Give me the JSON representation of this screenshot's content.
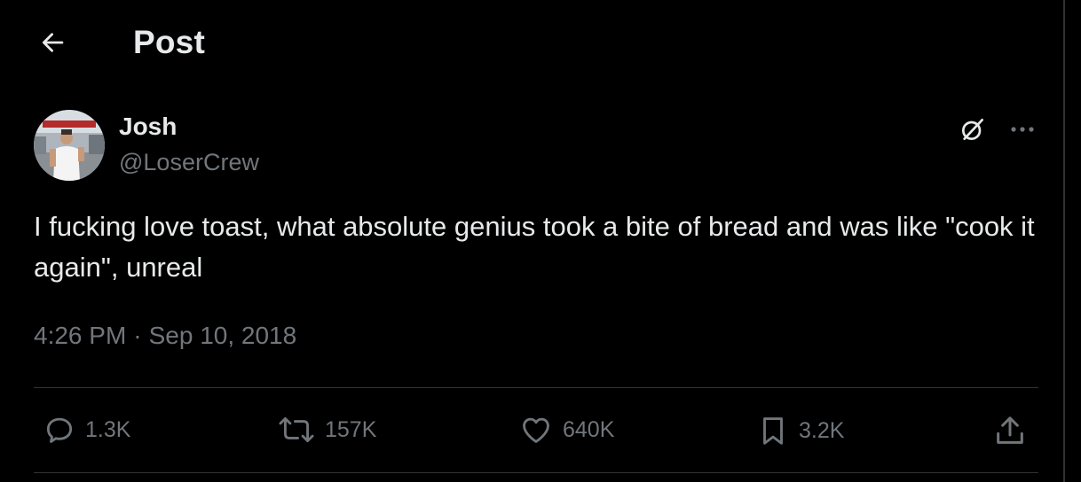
{
  "header": {
    "title": "Post",
    "back_icon": "arrow-left-icon"
  },
  "author": {
    "name": "Josh",
    "handle": "@LoserCrew"
  },
  "tweet": {
    "text": "I fucking love toast, what absolute genius took a bite of bread and was like \"cook it again\", unreal",
    "time": "4:26 PM",
    "separator": "·",
    "date": "Sep 10, 2018"
  },
  "actions": {
    "replies": "1.3K",
    "reposts": "157K",
    "likes": "640K",
    "bookmarks": "3.2K"
  },
  "icons": {
    "grok": "slash-circle-icon",
    "more": "more-horizontal-icon",
    "reply": "chat-bubble-icon",
    "repost": "repost-icon",
    "like": "heart-icon",
    "bookmark": "bookmark-icon",
    "share": "share-icon"
  },
  "colors": {
    "background": "#000000",
    "primary_text": "#e7e9ea",
    "secondary_text": "#71767b",
    "divider": "#2f3336"
  }
}
